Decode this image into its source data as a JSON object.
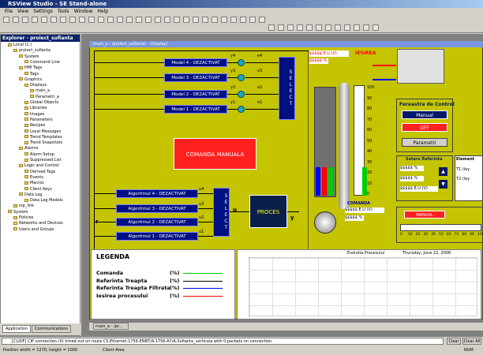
{
  "app": {
    "title": "RSView Studio - SE Stand-alone"
  },
  "menu": [
    "File",
    "View",
    "Settings",
    "Tools",
    "Window",
    "Help"
  ],
  "explorer": {
    "title": "Explorer - proiect_sufianta",
    "tree": [
      "Local (C:)",
      "proiect_sufianta",
      "System",
      "Command Line",
      "HMI Tags",
      "Tags",
      "Graphics",
      "Displays",
      "main_a",
      "Parametri_a",
      "Global Objects",
      "Libraries",
      "Images",
      "Parameters",
      "Recipes",
      "Local Messages",
      "Trend Templates",
      "Trend Snapshots",
      "Alarms",
      "Alarm Setup",
      "Suppressed List",
      "Logic and Control",
      "Derived Tags",
      "Events",
      "Macros",
      "Client Keys",
      "Data Log",
      "Data Log Models",
      "rsp_link",
      "System",
      "Policies",
      "Networks and Devices",
      "Users and Groups"
    ],
    "tabs": [
      "Application",
      "Communications"
    ]
  },
  "doc": {
    "title": "/main_a - /proiect_sufianta/ - (Display)",
    "models": [
      "Model 4 - DEZACTIVAT",
      "Model 3 - DEZACTIVAT",
      "Model 2 - DEZACTIVAT",
      "Model 1 - DEZACTIVAT"
    ],
    "model_y": [
      "y4",
      "y3",
      "y2",
      "y1"
    ],
    "model_e": [
      "e4",
      "e3",
      "e2",
      "e1"
    ],
    "select_label": "SELECT",
    "comanda_manuala": "COMANDA MANUALA",
    "algos": [
      "Algoritmul 4 - DEZACTIVAT",
      "Algoritmul 3 - DEZACTIVAT",
      "Algoritmul 2 - DEZACTIVAT",
      "Algoritmul 1 - DEZACTIVAT"
    ],
    "algo_u": [
      "u4",
      "u3",
      "u2",
      "u1"
    ],
    "u_label": "u",
    "r_label": "r",
    "y_label": "y",
    "proces": "PROCES",
    "iesirea": "IESIREA",
    "eu_value": "$$$$$ E.U (V)",
    "pct_value": "$$$$$ %",
    "comanda": "COMANDA",
    "scale": [
      "100",
      "90",
      "80",
      "70",
      "60",
      "50",
      "40",
      "30",
      "20",
      "10",
      "0"
    ],
    "fereastra": "Fereastra de Control",
    "manual_btn": "Manual",
    "off_btn": "OFF",
    "parametri_btn": "Parametri",
    "setare": "Setare Referinta",
    "elem": "Element",
    "t1": "T1 (ley",
    "t2": "T2 (ley",
    "manual_small": "MANUAL",
    "slider_scale": [
      "0",
      "10",
      "20",
      "30",
      "40",
      "50",
      "60",
      "70",
      "80",
      "90",
      "100"
    ]
  },
  "legend": {
    "title": "LEGENDA",
    "items": [
      {
        "label": "Comanda",
        "unit": "(%)",
        "color": "#00cc00"
      },
      {
        "label": "Referinta Treapta",
        "unit": "(%)",
        "color": "#000000"
      },
      {
        "label": "Referinta Treapta Filtrata",
        "unit": "(%)",
        "color": "#0000ff"
      },
      {
        "label": "Iesirea procesului",
        "unit": "(%)",
        "color": "#ff0000"
      }
    ]
  },
  "trend": {
    "title": "Evolutia Procesului",
    "date": "Thursday, June 22, 2006"
  },
  "taskbar": {
    "item": "main_a - /pr..."
  },
  "status": {
    "message": "[CLIDF] CIP connection (0) timed out on route CS.Ethernet.1756-ENBT/A.1756-A7/A.Sufianta_verticala with 0 packets on connection.",
    "clear": "Clear",
    "clear_all": "Clear All",
    "position": "Position width = 1270, height = 1000",
    "client_area": "Client Area",
    "num": "NUM"
  }
}
